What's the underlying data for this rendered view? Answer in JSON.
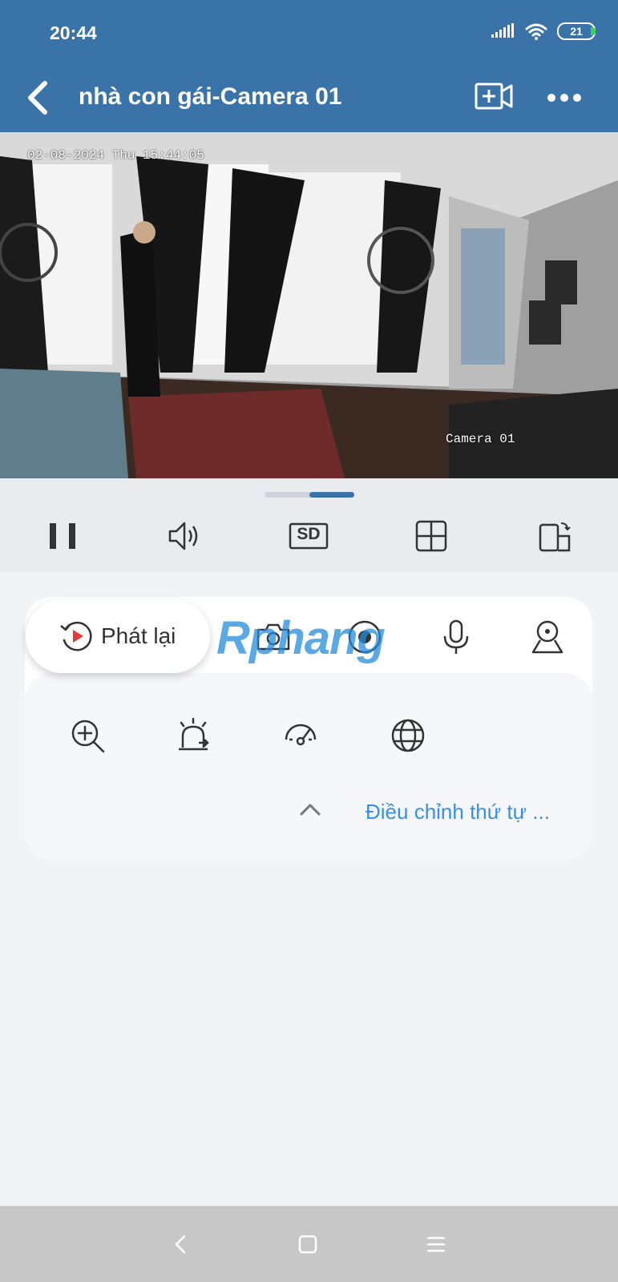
{
  "status_bar": {
    "time": "20:44",
    "battery": "21"
  },
  "header": {
    "title": "nhà con gái-Camera 01"
  },
  "video": {
    "osd_timestamp": "02-08-2024 Thu 15:44:05",
    "osd_camera_name": "Camera 01"
  },
  "controls": {
    "quality_label": "SD"
  },
  "playback": {
    "label": "Phát lại"
  },
  "watermark": {
    "text": "Rphang"
  },
  "order_link": {
    "label": "Điều chỉnh thứ tự ..."
  },
  "icons": [
    "back-icon",
    "add-camera-icon",
    "more-icon",
    "pause-icon",
    "volume-icon",
    "sd-icon",
    "grid-icon",
    "rotate-screen-icon",
    "playback-icon",
    "camera-snapshot-icon",
    "record-icon",
    "microphone-icon",
    "ptz-icon",
    "zoom-in-icon",
    "alarm-icon",
    "speed-icon",
    "globe-icon",
    "chevron-up-icon"
  ],
  "colors": {
    "header": "#3a73a8",
    "accent": "#3a8ee6",
    "playback_red": "#e53935"
  }
}
